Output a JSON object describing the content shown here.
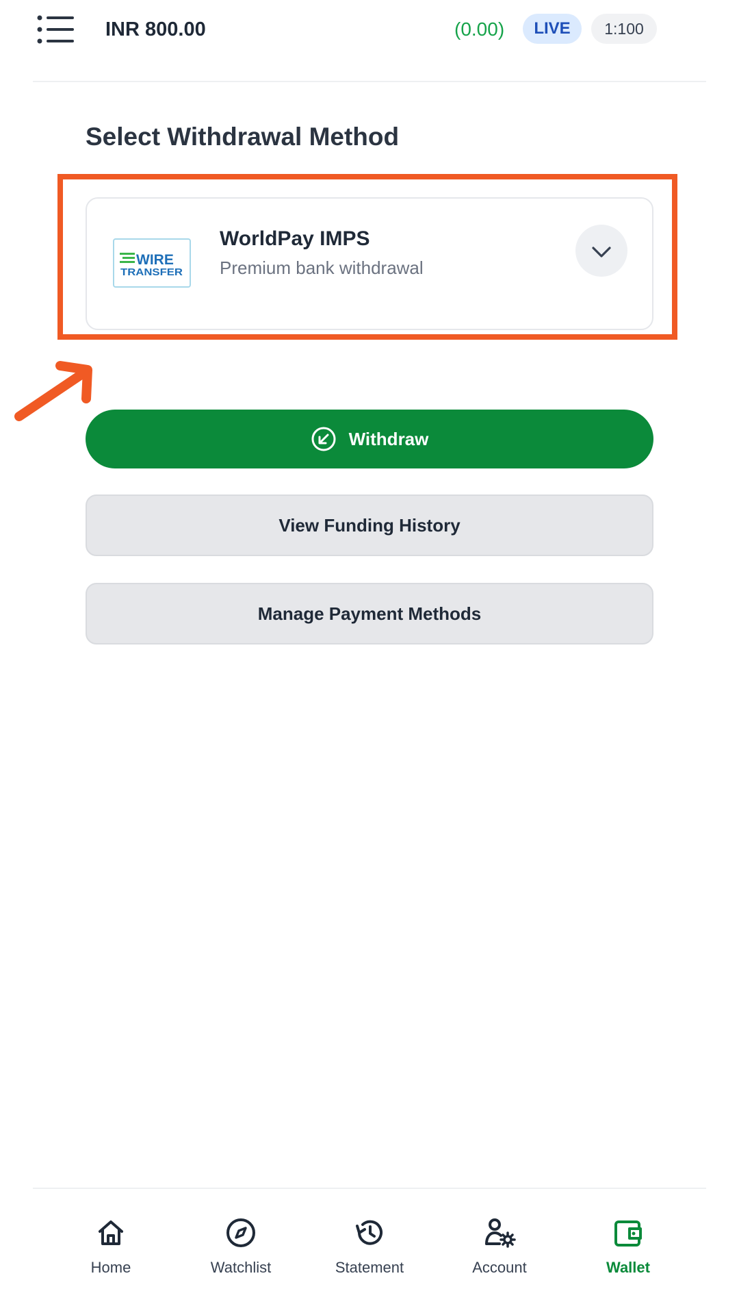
{
  "header": {
    "balance": "INR 800.00",
    "pnl": "(0.00)",
    "mode_badge": "LIVE",
    "leverage": "1:100"
  },
  "withdrawal": {
    "title": "Select Withdrawal Method",
    "method": {
      "name": "WorldPay IMPS",
      "description": "Premium bank withdrawal",
      "logo_text_top": "WIRE",
      "logo_text_bottom": "TRANSFER"
    }
  },
  "actions": {
    "withdraw": "Withdraw",
    "history": "View Funding History",
    "manage": "Manage Payment Methods"
  },
  "nav": {
    "items": [
      {
        "label": "Home",
        "icon": "home-icon"
      },
      {
        "label": "Watchlist",
        "icon": "compass-icon"
      },
      {
        "label": "Statement",
        "icon": "history-icon"
      },
      {
        "label": "Account",
        "icon": "user-settings-icon"
      },
      {
        "label": "Wallet",
        "icon": "wallet-icon",
        "active": true
      }
    ]
  },
  "colors": {
    "accent_green": "#0b8a3a",
    "annotation_orange": "#f05a24",
    "pnl_green": "#16a34a",
    "live_blue": "#1e4fb8"
  }
}
